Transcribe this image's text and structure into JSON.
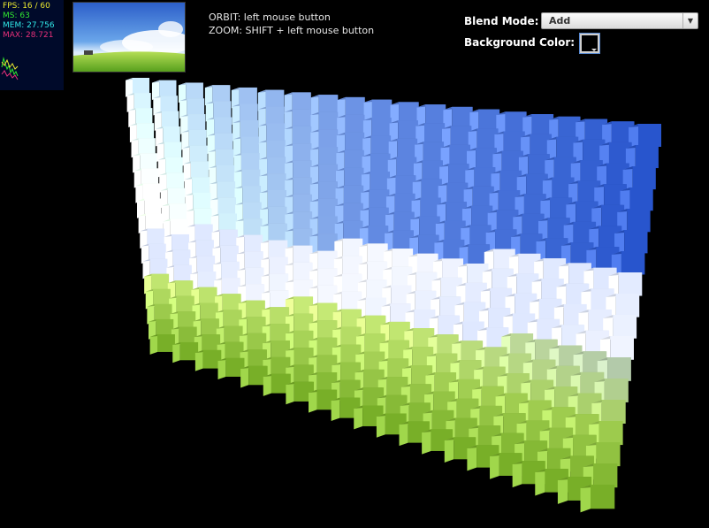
{
  "stats": {
    "fps": "FPS: 16 / 60",
    "ms": "MS: 63",
    "mem": "MEM: 27.756",
    "max": "MAX: 28.721",
    "colors": {
      "fps": "#e8e830",
      "ms": "#30e830",
      "mem": "#30e8e8",
      "max": "#e8307a"
    }
  },
  "help": {
    "line1": "ORBIT: left mouse button",
    "line2": "ZOOM: SHIFT + left mouse button"
  },
  "gui": {
    "blend_mode_label": "Blend Mode:",
    "blend_mode_value": "Add",
    "background_color_label": "Background Color:",
    "background_color_value": "#000000"
  },
  "scene": {
    "icon": "voxel-cube-grid",
    "palette": {
      "sky": "#2a55c8",
      "cloud": "#f2f6ff",
      "grass": "#7fbf2a",
      "background": "#000000"
    }
  }
}
